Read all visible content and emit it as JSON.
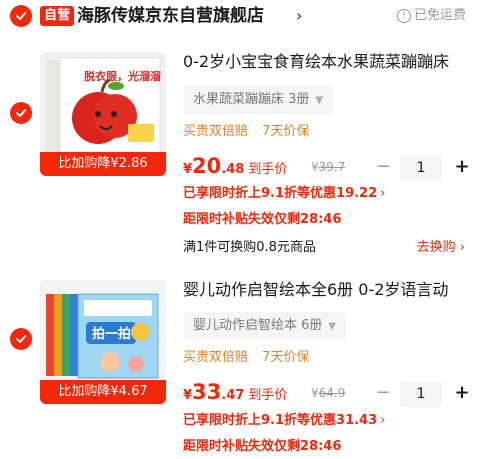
{
  "store": {
    "badge": "自营",
    "name": "海豚传媒京东自营旗舰店",
    "arrow": "›",
    "free_shipping": "已免运费"
  },
  "items": [
    {
      "title": "0-2岁小宝宝食育绘本水果蔬菜蹦蹦床",
      "spec": "水果蔬菜蹦蹦床 3册",
      "services": [
        "买贵双倍赔",
        "7天价保"
      ],
      "price_currency": "¥",
      "price_int": "20",
      "price_dec": ".48",
      "price_tag": "到手价",
      "orig_currency": "¥",
      "orig_price": "39.7",
      "qty": "1",
      "thumb_label": "比加购降¥2.86",
      "promo1": "已享限时折上9.1折等优惠19.22",
      "promo2": "距限时补贴失效仅剩28:46",
      "swap_text": "满1件可换购0.8元商品",
      "swap_link": "去换购",
      "cover_title": "脱衣服，光溜溜"
    },
    {
      "title": "婴儿动作启智绘本全6册 0-2岁语言动",
      "spec": "婴儿动作启智绘本 6册",
      "services": [
        "买贵双倍赔",
        "7天价保"
      ],
      "price_currency": "¥",
      "price_int": "33",
      "price_dec": ".47",
      "price_tag": "到手价",
      "orig_currency": "¥",
      "orig_price": "64.9",
      "qty": "1",
      "thumb_label": "比加购降¥4.67",
      "promo1": "已享限时折上9.1折等优惠31.43",
      "promo2": "距限时补贴失效仅剩28:46",
      "cover_title": "拍一拍"
    }
  ],
  "stepper": {
    "minus": "−",
    "plus": "+"
  },
  "colors": {
    "accent": "#f2270c",
    "service": "#e5821e",
    "muted": "#999999"
  }
}
